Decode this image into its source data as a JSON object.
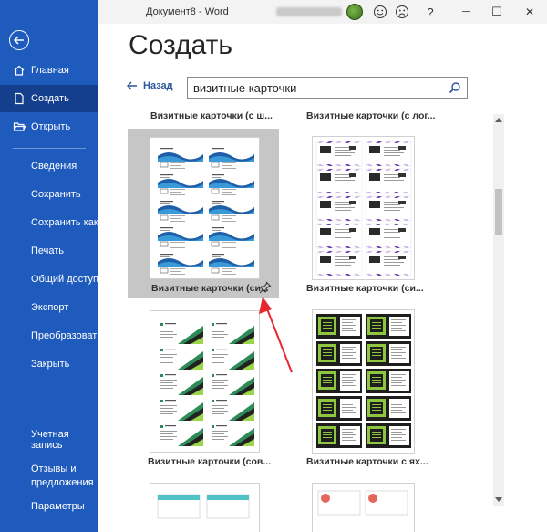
{
  "window": {
    "title": "Документ8  -  Word",
    "accent": "#1f5bbd",
    "buttons": [
      "smile-icon",
      "frown-icon",
      "help",
      "minimize",
      "maximize",
      "close"
    ],
    "help_label": "?",
    "minimize_label": "─",
    "maximize_label": "☐",
    "close_label": "✕"
  },
  "sidebar": {
    "top_items": [
      {
        "label": "Главная",
        "icon": "home-icon"
      },
      {
        "label": "Создать",
        "icon": "new-document-icon",
        "active": true
      },
      {
        "label": "Открыть",
        "icon": "folder-open-icon"
      }
    ],
    "items": [
      {
        "label": "Сведения"
      },
      {
        "label": "Сохранить"
      },
      {
        "label": "Сохранить как"
      },
      {
        "label": "Печать"
      },
      {
        "label": "Общий доступ"
      },
      {
        "label": "Экспорт"
      },
      {
        "label": "Преобразовать"
      },
      {
        "label": "Закрыть"
      }
    ],
    "bottom_items": [
      {
        "label": "Учетная запись"
      },
      {
        "label": "Отзывы и предложения",
        "line1": "Отзывы и",
        "line2": "предложения"
      },
      {
        "label": "Параметры"
      }
    ]
  },
  "main": {
    "title": "Создать",
    "back_label": "Назад",
    "search": {
      "value": "визитные карточки"
    },
    "top_labels": [
      "Визитные карточки (с ш...",
      "Визитные карточки (с лог..."
    ],
    "templates": [
      {
        "label": "Визитные карточки (си...",
        "selected": true,
        "pinned": true
      },
      {
        "label": "Визитные карточки (си..."
      },
      {
        "label": "Визитные карточки (сов..."
      },
      {
        "label": "Визитные карточки с ях..."
      }
    ],
    "green_card_text": "МЕСТО ДЛЯ ЛОГОТИПА"
  }
}
